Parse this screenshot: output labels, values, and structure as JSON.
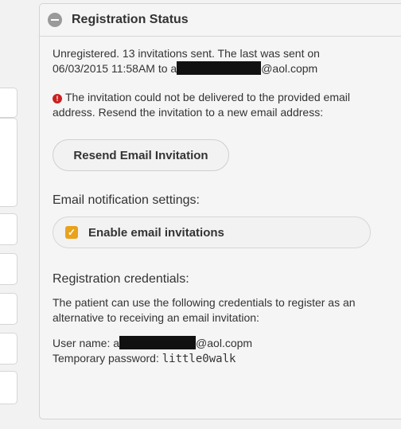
{
  "panel": {
    "title": "Registration Status",
    "status_line_1": "Unregistered. 13 invitations sent. The last was sent on",
    "status_date": "06/03/2015 11:58AM to a",
    "status_email_suffix": "@aol.copm",
    "error_message": "The invitation could not be delivered to the provided email address. Resend the invitation to a new email address:",
    "resend_button": "Resend Email Invitation",
    "notification_heading": "Email notification settings:",
    "enable_invitations_label": "Enable email invitations",
    "enable_invitations_checked": true,
    "credentials_heading": "Registration credentials:",
    "credentials_description": "The patient can use the following credentials to register as an alternative to receiving an email invitation:",
    "username_label": "User name: a",
    "username_suffix": "@aol.copm",
    "password_label": "Temporary password:",
    "password_value": "little0walk"
  },
  "colors": {
    "accent_checkbox": "#e9a21a",
    "error_icon": "#cc1f1f",
    "redaction": "#111111"
  }
}
